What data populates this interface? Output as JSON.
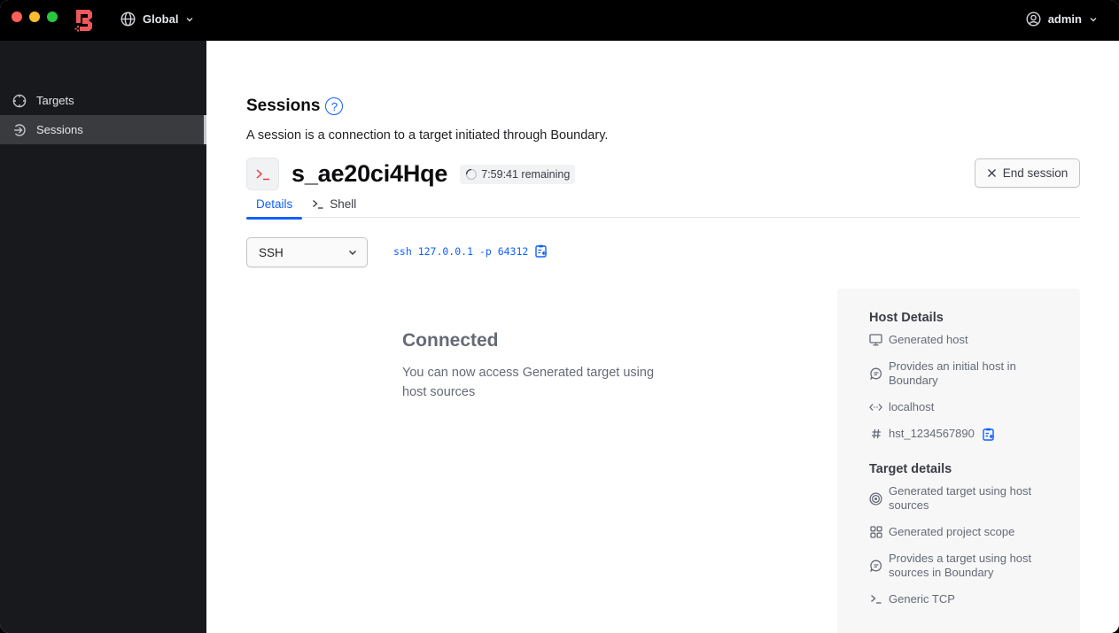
{
  "app": {
    "logo": "boundary-logo",
    "scope_label": "Global",
    "user_label": "admin",
    "colors": {
      "accent": "#1060ff",
      "brand": "#ec585d",
      "sidebar": "#18191c"
    }
  },
  "sidebar": {
    "items": [
      {
        "label": "Targets",
        "icon": "crosshair-icon",
        "active": false
      },
      {
        "label": "Sessions",
        "icon": "entry-icon",
        "active": true
      }
    ]
  },
  "page": {
    "title": "Sessions",
    "help_icon": "?",
    "description": "A session is a connection to a target initiated through Boundary."
  },
  "session": {
    "id": "s_ae20ci4Hqe",
    "remaining": "7:59:41 remaining",
    "end_label": "End session",
    "tabs": [
      {
        "label": "Details",
        "active": true
      },
      {
        "label": "Shell",
        "active": false
      }
    ],
    "protocol_select": "SSH",
    "command": "ssh 127.0.0.1 -p 64312"
  },
  "empty_state": {
    "title": "Connected",
    "message": "You can now access Generated target using host sources"
  },
  "host_details": {
    "heading": "Host Details",
    "items": [
      {
        "icon": "monitor-icon",
        "text": "Generated host"
      },
      {
        "icon": "message-icon",
        "text": "Provides an initial host in Boundary"
      },
      {
        "icon": "code-icon",
        "text": "localhost"
      },
      {
        "icon": "hash-icon",
        "text": "hst_1234567890",
        "copyable": true
      }
    ]
  },
  "target_details": {
    "heading": "Target details",
    "items": [
      {
        "icon": "target-icon",
        "text": "Generated target using host sources"
      },
      {
        "icon": "grid-icon",
        "text": "Generated project scope"
      },
      {
        "icon": "message-icon",
        "text": "Provides a target using host sources in Boundary"
      },
      {
        "icon": "terminal-icon",
        "text": "Generic TCP"
      }
    ]
  }
}
